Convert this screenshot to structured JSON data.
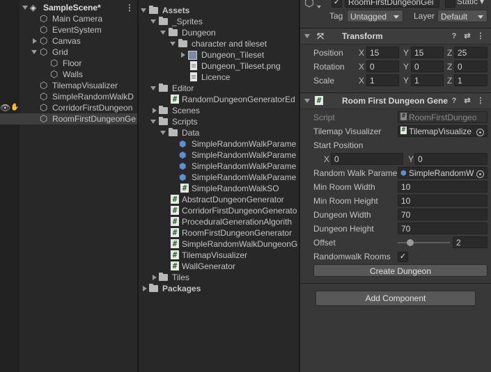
{
  "hierarchy": {
    "scene": "SampleScene*",
    "items": [
      {
        "label": "Main Camera"
      },
      {
        "label": "EventSystem"
      },
      {
        "label": "Canvas"
      },
      {
        "label": "Grid"
      },
      {
        "label": "Floor"
      },
      {
        "label": "Walls"
      },
      {
        "label": "TilemapVisualizer"
      },
      {
        "label": "SimpleRandomWalkD"
      },
      {
        "label": "CorridorFirstDungeon"
      },
      {
        "label": "RoomFirstDungeonGe"
      }
    ]
  },
  "project": {
    "items": [
      {
        "label": "Assets"
      },
      {
        "label": "_Sprites"
      },
      {
        "label": "Dungeon"
      },
      {
        "label": "character and tileset"
      },
      {
        "label": "Dungeon_Tileset"
      },
      {
        "label": "Dungeon_Tileset.png"
      },
      {
        "label": "Licence"
      },
      {
        "label": "Editor"
      },
      {
        "label": "RandomDungeonGeneratorEd"
      },
      {
        "label": "Scenes"
      },
      {
        "label": "Scripts"
      },
      {
        "label": "Data"
      },
      {
        "label": "SimpleRandomWalkParame"
      },
      {
        "label": "SimpleRandomWalkParame"
      },
      {
        "label": "SimpleRandomWalkParame"
      },
      {
        "label": "SimpleRandomWalkParame"
      },
      {
        "label": "SimpleRandomWalkSO"
      },
      {
        "label": "AbstractDungeonGenerator"
      },
      {
        "label": "CorridorFirstDungeonGenerato"
      },
      {
        "label": "ProceduralGenerationAlgorith"
      },
      {
        "label": "RoomFirstDungeonGenerator"
      },
      {
        "label": "SimpleRandomWalkDungeonG"
      },
      {
        "label": "TilemapVisualizer"
      },
      {
        "label": "WallGenerator"
      },
      {
        "label": "Tiles"
      },
      {
        "label": "Packages"
      }
    ]
  },
  "inspector": {
    "object_name": "RoomFirstDungeonGei",
    "static_label": "Static",
    "tag_label": "Tag",
    "tag_value": "Untagged",
    "layer_label": "Layer",
    "layer_value": "Default",
    "transform": {
      "title": "Transform",
      "position_label": "Position",
      "rotation_label": "Rotation",
      "scale_label": "Scale",
      "position": {
        "x": "15",
        "y": "15",
        "z": "25"
      },
      "rotation": {
        "x": "0",
        "y": "0",
        "z": "0"
      },
      "scale": {
        "x": "1",
        "y": "1",
        "z": "1"
      }
    },
    "axis": {
      "x": "X",
      "y": "Y",
      "z": "Z"
    },
    "component": {
      "title": "Room First Dungeon Gene",
      "script_label": "Script",
      "script_value": "RoomFirstDungeo",
      "tilemap_label": "Tilemap Visualizer",
      "tilemap_value": "TilemapVisualize",
      "start_label": "Start Position",
      "start_x": "0",
      "start_y": "0",
      "walk_label": "Random Walk Parame",
      "walk_value": "SimpleRandomW",
      "min_w_label": "Min Room Width",
      "min_w": "10",
      "min_h_label": "Min Room Height",
      "min_h": "10",
      "dw_label": "Dungeon Width",
      "dw": "70",
      "dh_label": "Dungeon Height",
      "dh": "70",
      "offset_label": "Offset",
      "offset": "2",
      "rooms_label": "Randomwalk Rooms",
      "create_button": "Create Dungeon"
    },
    "add_component": "Add Component"
  }
}
